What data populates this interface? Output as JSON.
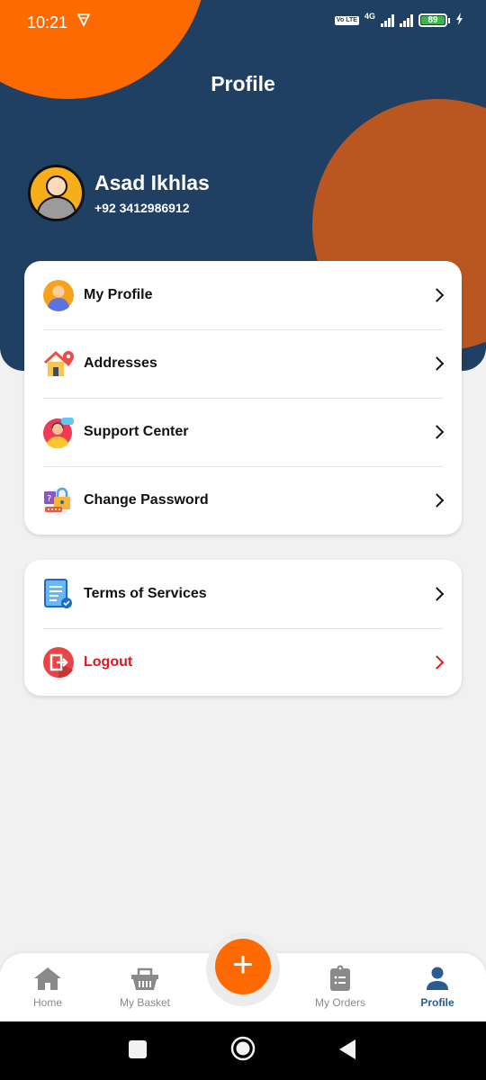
{
  "status_bar": {
    "time": "10:21",
    "network": "4G",
    "volte": "Vo LTE",
    "battery": "89",
    "battery_level_percent": 89
  },
  "header": {
    "title": "Profile"
  },
  "user": {
    "name": "Asad Ikhlas",
    "phone": "+92 3412986912"
  },
  "menu_primary": [
    {
      "label": "My Profile",
      "icon": "user-profile-icon"
    },
    {
      "label": "Addresses",
      "icon": "house-location-icon"
    },
    {
      "label": "Support Center",
      "icon": "support-agent-icon"
    },
    {
      "label": "Change Password",
      "icon": "password-lock-icon"
    }
  ],
  "menu_secondary": [
    {
      "label": "Terms of Services",
      "icon": "document-check-icon"
    },
    {
      "label": "Logout",
      "icon": "logout-icon"
    }
  ],
  "bottom_nav": {
    "items": [
      {
        "label": "Home",
        "icon": "home-icon",
        "active": false
      },
      {
        "label": "My Basket",
        "icon": "basket-icon",
        "active": false
      },
      {
        "label": "My Orders",
        "icon": "clipboard-list-icon",
        "active": false
      },
      {
        "label": "Profile",
        "icon": "person-icon",
        "active": true
      }
    ],
    "fab_label": "+"
  },
  "colors": {
    "header_bg": "#1f3f63",
    "accent_orange": "#ff6a00",
    "blob_orange": "#ba5720",
    "danger": "#e3141e",
    "nav_active": "#2c5b92",
    "nav_inactive": "#8a8a8a"
  }
}
